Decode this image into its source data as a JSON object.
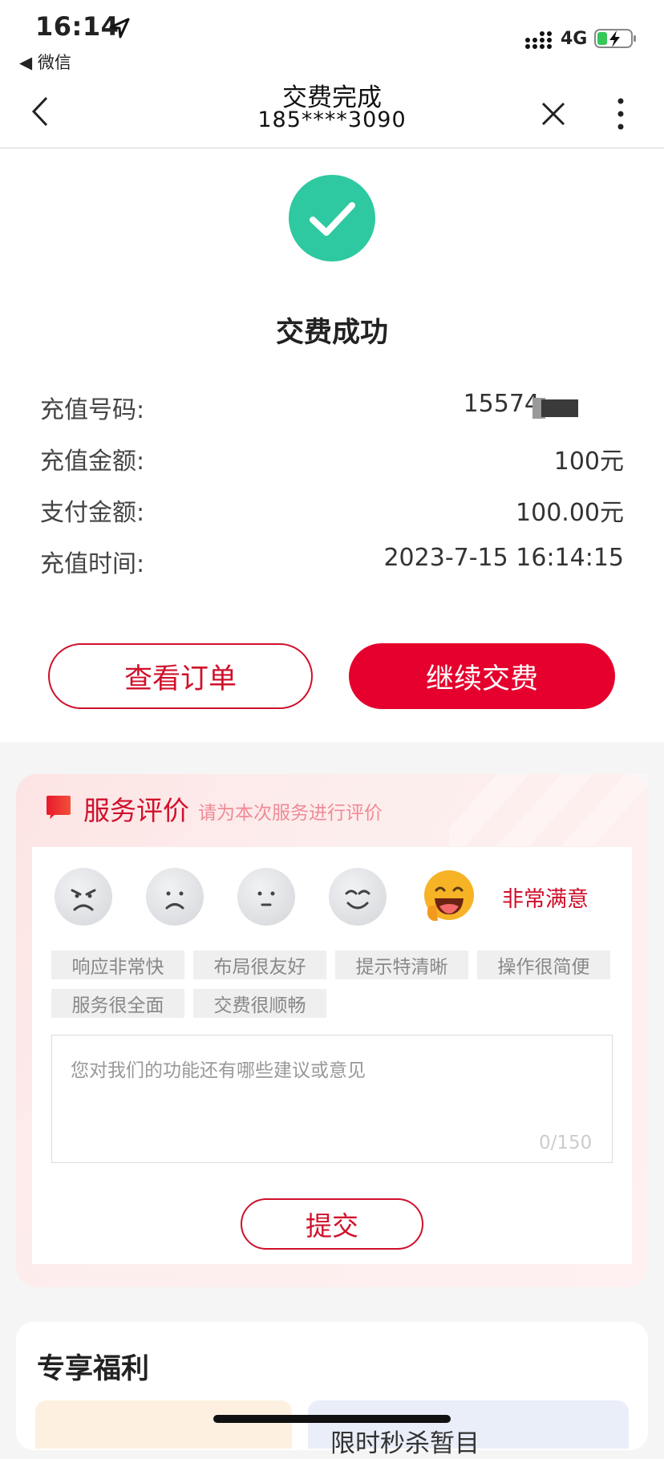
{
  "status_bar": {
    "time": "16:14",
    "back_app": "◀ 微信",
    "network": "4G"
  },
  "nav": {
    "title": "交费完成",
    "subtitle": "185****3090"
  },
  "result": {
    "title": "交费成功",
    "rows": [
      {
        "label": "充值号码:",
        "value": "15574"
      },
      {
        "label": "充值金额:",
        "value": "100元"
      },
      {
        "label": "支付金额:",
        "value": "100.00元"
      },
      {
        "label": "充值时间:",
        "value": "2023-7-15 16:14:15"
      }
    ],
    "view_order_label": "查看订单",
    "continue_label": "继续交费"
  },
  "rating": {
    "title": "服务评价",
    "subtitle": "请为本次服务进行评价",
    "selected_label": "非常满意",
    "tags": [
      "响应非常快",
      "布局很友好",
      "提示特清晰",
      "操作很简便",
      "服务很全面",
      "交费很顺畅"
    ],
    "comment_placeholder": "您对我们的功能还有哪些建议或意见",
    "comment_count": "0/150",
    "submit_label": "提交"
  },
  "benefits": {
    "title": "专享福利",
    "card_right_text": "限时秒杀暂目"
  },
  "colors": {
    "brand_red": "#e5002d",
    "success_green": "#2ec9a0"
  }
}
